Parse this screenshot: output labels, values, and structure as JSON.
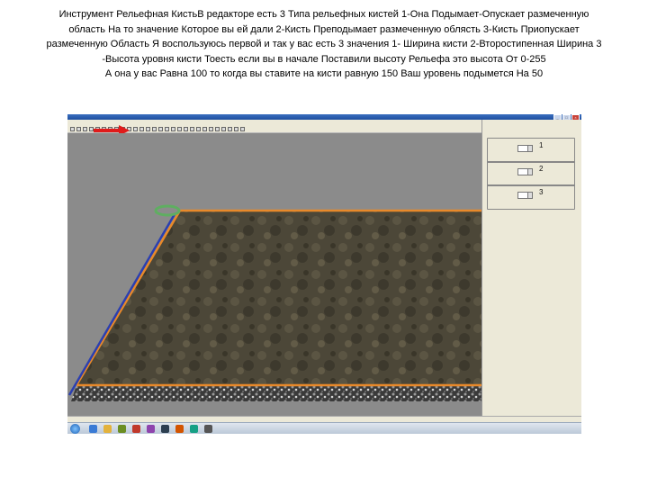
{
  "caption": {
    "lines": [
      "Инструмент Рельефная КистьВ редакторе есть 3 Типа рельефных кистей 1-Она Подымает-Опускает размеченную",
      "область На то значение Которое вы ей дали 2-Кисть Преподымает размеченную облясть 3-Кисть Приопускает",
      "размеченную Область Я воспользуюсь первой и так у вас есть 3 значения 1- Ширина кисти 2-Второстипенная Ширина 3",
      "-Высота уровня кисти    Тоесть если вы в начале Поставили высоту Рельефа  это высота От 0-255",
      "А она у вас Равна 100 то когда вы ставите на кисти равную 150 Ваш уровень подымется На 50"
    ]
  },
  "panel": {
    "groups": [
      {
        "number": "1"
      },
      {
        "number": "2"
      },
      {
        "number": "3"
      }
    ]
  },
  "colors": {
    "terrain_edge": "#e8892a",
    "terrain_edge_blue": "#2b3fb0",
    "arrow": "#e01b1b"
  }
}
